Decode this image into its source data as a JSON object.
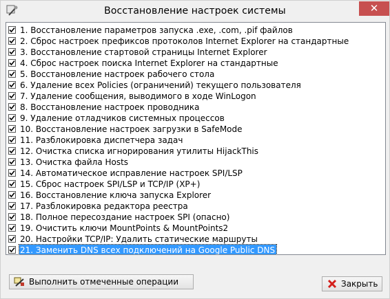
{
  "window": {
    "title": "Восстановление настроек системы",
    "close_glyph": "✕"
  },
  "items": [
    {
      "label": "1. Восстановление параметров запуска .exe, .com, .pif файлов",
      "checked": true
    },
    {
      "label": "2. Сброс настроек префиксов протоколов Internet Explorer на стандартные",
      "checked": true
    },
    {
      "label": "3. Восстановление стартовой страницы Internet Explorer",
      "checked": true
    },
    {
      "label": "4. Сброс настроек поиска Internet Explorer на стандартные",
      "checked": true
    },
    {
      "label": "5. Восстановление настроек рабочего стола",
      "checked": true
    },
    {
      "label": "6. Удаление всех Policies (ограничений) текущего пользователя",
      "checked": true
    },
    {
      "label": "7. Удаление сообщения, выводимого в ходе WinLogon",
      "checked": true
    },
    {
      "label": "8. Восстановление настроек проводника",
      "checked": true
    },
    {
      "label": "9. Удаление отладчиков системных процессов",
      "checked": true
    },
    {
      "label": "10. Восстановление настроек загрузки в SafeMode",
      "checked": true
    },
    {
      "label": "11. Разблокировка диспетчера задач",
      "checked": true
    },
    {
      "label": "12. Очистка списка игнорирования утилиты HijackThis",
      "checked": true
    },
    {
      "label": "13. Очистка файла Hosts",
      "checked": true
    },
    {
      "label": "14. Автоматическое исправление настроек SPI/LSP",
      "checked": true
    },
    {
      "label": "15. Сброс настроек SPI/LSP и TCP/IP (XP+)",
      "checked": true
    },
    {
      "label": "16. Восстановление ключа запуска Explorer",
      "checked": true
    },
    {
      "label": "17. Разблокировка редактора реестра",
      "checked": true
    },
    {
      "label": "18. Полное пересоздание настроек SPI (опасно)",
      "checked": true
    },
    {
      "label": "19. Очистить ключи MountPoints & MountPoints2",
      "checked": true
    },
    {
      "label": "20. Настройки TCP/IP: Удалить статические маршруты",
      "checked": true
    },
    {
      "label": "21. Заменить DNS всех подключений на Google Public DNS",
      "checked": true,
      "selected": true
    }
  ],
  "buttons": {
    "execute_label": "Выполнить отмеченные операции",
    "execute_icon": "tools-icon",
    "close_label": "Закрыть",
    "close_icon": "red-x-icon"
  },
  "colors": {
    "selection": "#3399ff",
    "close_button": "#c75050",
    "red_x": "#d4201c"
  }
}
